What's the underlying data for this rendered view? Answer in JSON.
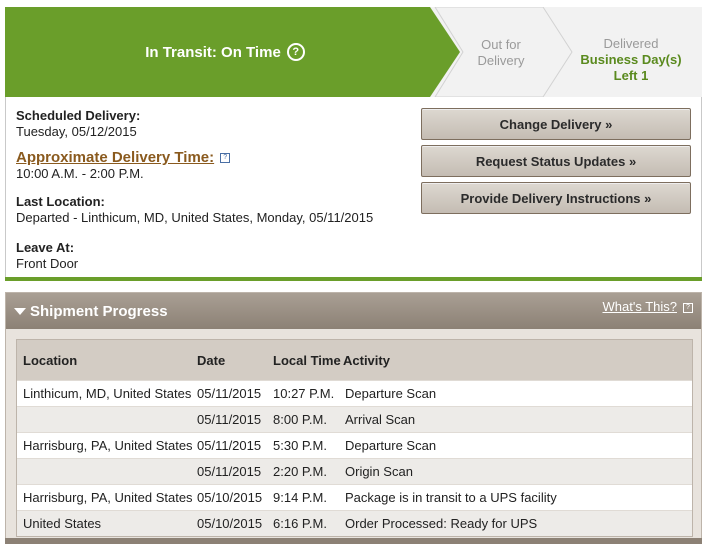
{
  "status": {
    "current": "In Transit: On Time",
    "help_icon": "?",
    "steps": [
      {
        "line1": "Out for",
        "line2": "Delivery"
      },
      {
        "line1": "Delivered",
        "highlight": "Business Day(s) Left 1"
      }
    ],
    "colors": {
      "active": "#6a9e2a",
      "inactive": "#f2f2f2"
    }
  },
  "details": {
    "scheduled_label": "Scheduled Delivery:",
    "scheduled_value": "Tuesday, 05/12/2015",
    "approx_label": "Approximate Delivery Time:",
    "approx_value": "10:00 A.M. - 2:00 P.M.",
    "last_location_label": "Last Location:",
    "last_location_value": "Departed - Linthicum, MD, United States, Monday, 05/11/2015",
    "leave_at_label": "Leave At:",
    "leave_at_value": "Front Door"
  },
  "buttons": {
    "change": "Change Delivery »",
    "updates": "Request Status Updates »",
    "instructions": "Provide Delivery Instructions »"
  },
  "progress": {
    "title": "Shipment Progress",
    "whats_this": "What's This?",
    "columns": [
      "Location",
      "Date",
      "Local Time",
      "Activity"
    ],
    "rows": [
      {
        "location": "Linthicum, MD, United States",
        "date": "05/11/2015",
        "time": "10:27 P.M.",
        "activity": "Departure Scan"
      },
      {
        "location": "",
        "date": "05/11/2015",
        "time": "8:00 P.M.",
        "activity": "Arrival Scan"
      },
      {
        "location": "Harrisburg, PA, United States",
        "date": "05/11/2015",
        "time": "5:30 P.M.",
        "activity": "Departure Scan"
      },
      {
        "location": "",
        "date": "05/11/2015",
        "time": "2:20 P.M.",
        "activity": "Origin Scan"
      },
      {
        "location": "Harrisburg, PA, United States",
        "date": "05/10/2015",
        "time": "9:14 P.M.",
        "activity": "Package is in transit to a UPS facility"
      },
      {
        "location": "United States",
        "date": "05/10/2015",
        "time": "6:16 P.M.",
        "activity": "Order Processed: Ready for UPS"
      }
    ]
  }
}
